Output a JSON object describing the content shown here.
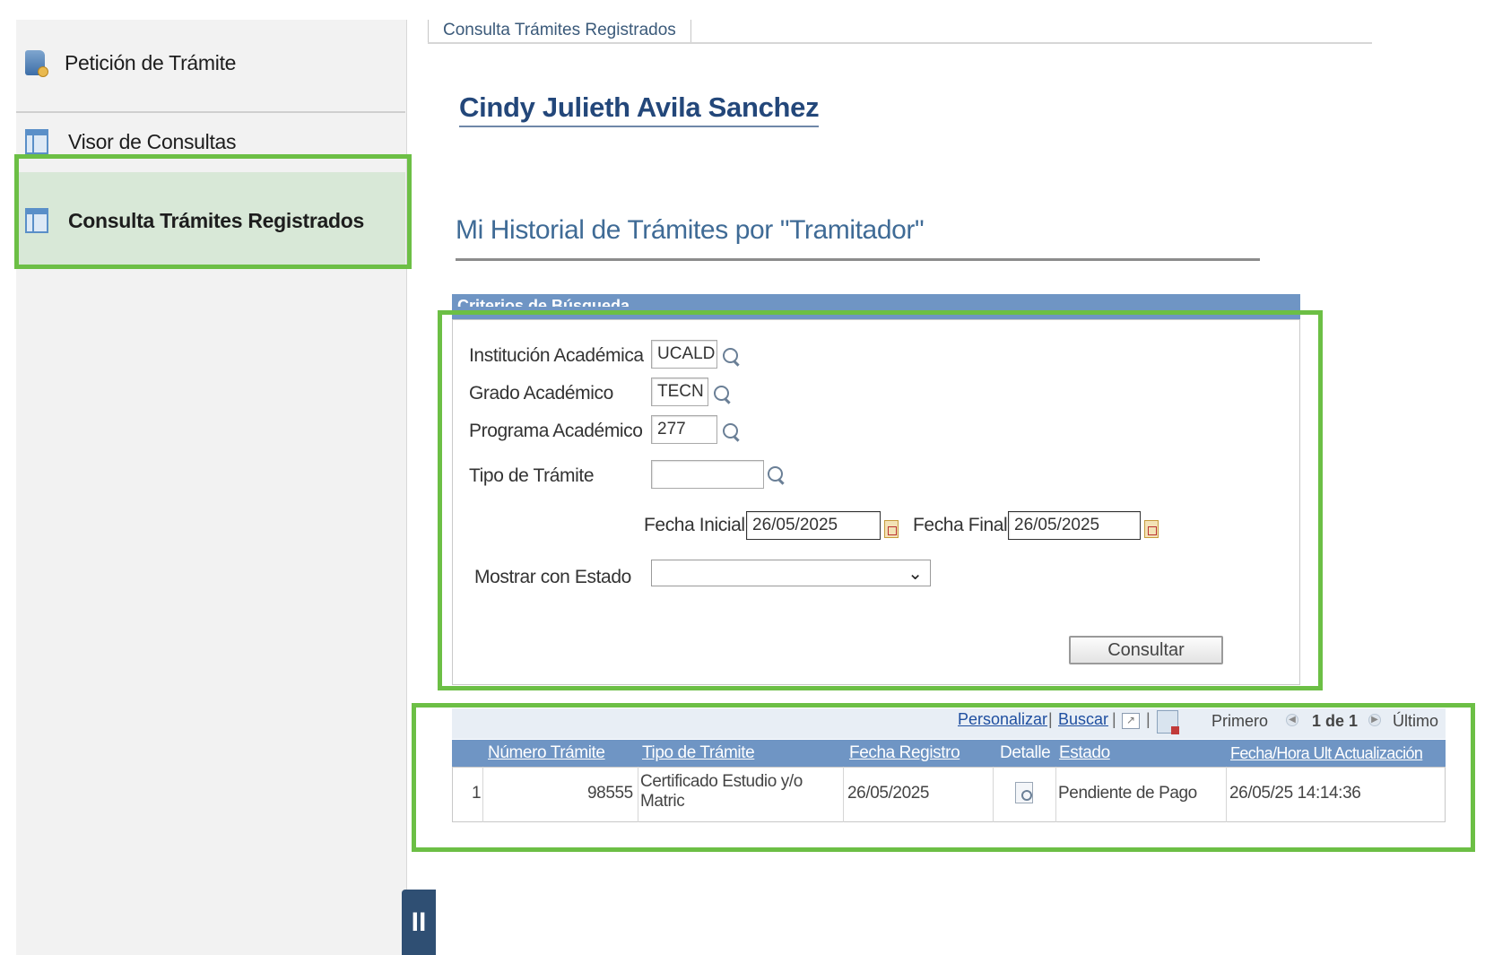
{
  "sidebar": {
    "items": [
      {
        "label": "Petición de Trámite",
        "icon": "document-icon"
      },
      {
        "label": "Visor de Consultas",
        "icon": "window-icon"
      },
      {
        "label": "Consulta Trámites Registrados",
        "icon": "window-icon",
        "selected": true
      }
    ]
  },
  "tab": {
    "label": "Consulta Trámites Registrados"
  },
  "user": {
    "name": "Cindy Julieth Avila Sanchez"
  },
  "history": {
    "title": "Mi Historial de Trámites por \"Tramitador\""
  },
  "criteria": {
    "header": "Criterios de Búsqueda",
    "institucion": {
      "label": "Institución Académica",
      "value": "UCALD"
    },
    "grado": {
      "label": "Grado Académico",
      "value": "TECN"
    },
    "programa": {
      "label": "Programa Académico",
      "value": "277"
    },
    "tipo": {
      "label": "Tipo de Trámite",
      "value": ""
    },
    "fecha_inicial": {
      "label": "Fecha Inicial",
      "value": "26/05/2025"
    },
    "fecha_final": {
      "label": "Fecha Final",
      "value": "26/05/2025"
    },
    "estado": {
      "label": "Mostrar con Estado",
      "value": ""
    },
    "consultar_label": "Consultar"
  },
  "grid": {
    "personalizar": "Personalizar",
    "buscar": "Buscar",
    "primero": "Primero",
    "page_info": "1 de 1",
    "ultimo": "Último",
    "columns": [
      "Número Trámite",
      "Tipo de Trámite",
      "Fecha Registro",
      "Detalle",
      "Estado",
      "Fecha/Hora Ult Actualización"
    ],
    "rows": [
      {
        "index": "1",
        "numero": "98555",
        "tipo": "Certificado Estudio y/o Matric",
        "fecha": "26/05/2025",
        "estado": "Pendiente de Pago",
        "actualizacion": "26/05/25 14:14:36"
      }
    ]
  },
  "colors": {
    "highlight": "#6cbf45",
    "header_blue": "#6f95c4",
    "title_blue": "#23477a"
  }
}
